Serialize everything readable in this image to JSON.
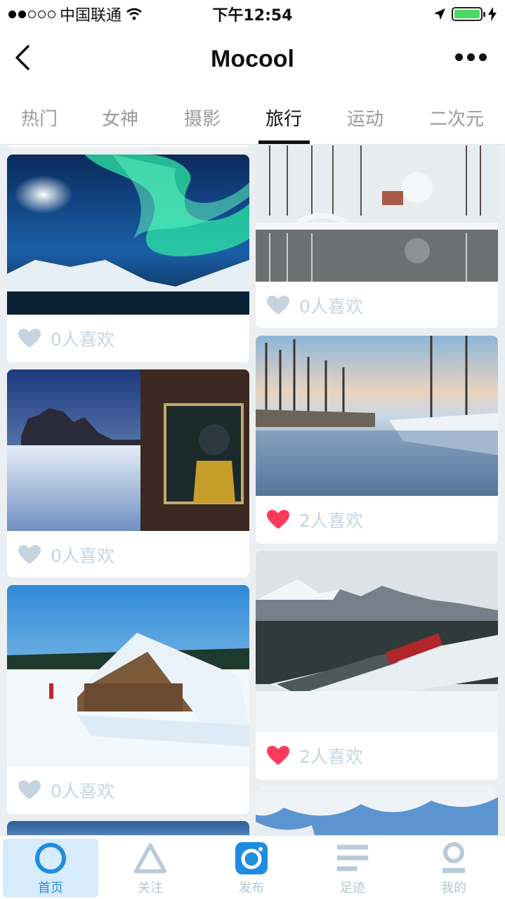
{
  "status_bar": {
    "carrier": "中国联通",
    "time": "下午12:54"
  },
  "nav": {
    "title": "Mocool"
  },
  "tabs": [
    {
      "label": "热门",
      "active": false
    },
    {
      "label": "女神",
      "active": false
    },
    {
      "label": "摄影",
      "active": false
    },
    {
      "label": "旅行",
      "active": true
    },
    {
      "label": "运动",
      "active": false
    },
    {
      "label": "二次元",
      "active": false
    }
  ],
  "feed": {
    "left": [
      {
        "likes": "0人喜欢",
        "liked": false,
        "image": "aurora-night-sky"
      },
      {
        "likes": "0人喜欢",
        "liked": false,
        "image": "cabin-window-mountains"
      },
      {
        "likes": "0人喜欢",
        "liked": false,
        "image": "snowy-chalet"
      }
    ],
    "right": [
      {
        "likes": "0人喜欢",
        "liked": false,
        "image": "snowy-park-reflection"
      },
      {
        "likes": "2人喜欢",
        "liked": true,
        "image": "frozen-river-forest"
      },
      {
        "likes": "2人喜欢",
        "liked": true,
        "image": "mountain-train"
      }
    ]
  },
  "colors": {
    "liked_heart": "#ff3b5c",
    "unliked_heart": "#c5d4e0",
    "accent": "#2b8fe0"
  },
  "bottom_tabs": [
    {
      "label": "首页",
      "icon": "home-ring-icon",
      "active": true
    },
    {
      "label": "关注",
      "icon": "triangle-icon",
      "active": false
    },
    {
      "label": "发布",
      "icon": "camera-icon",
      "active": false
    },
    {
      "label": "足迹",
      "icon": "lines-icon",
      "active": false
    },
    {
      "label": "我的",
      "icon": "person-icon",
      "active": false
    }
  ]
}
